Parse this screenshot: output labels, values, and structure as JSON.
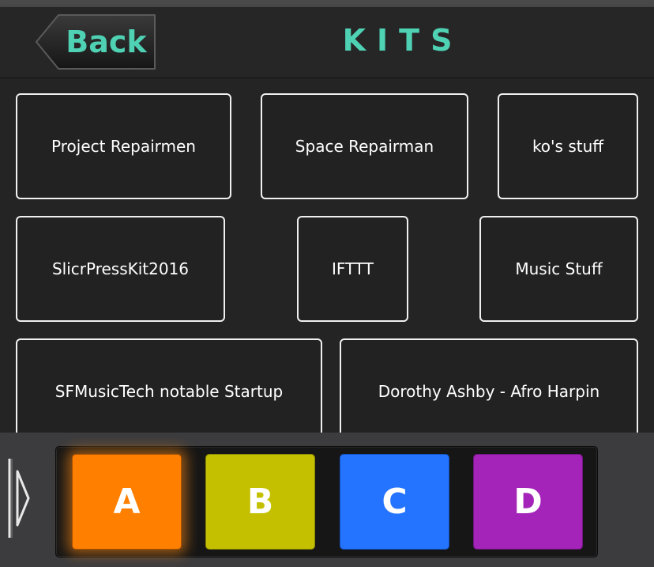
{
  "header": {
    "back_label": "Back",
    "title": "KITS"
  },
  "kits": [
    "Project Repairmen",
    "Space Repairman",
    "ko's stuff",
    "SlicrPressKit2016",
    "IFTTT",
    "Music Stuff",
    "SFMusicTech notable Startup",
    "Dorothy Ashby - Afro Harpin"
  ],
  "pads": [
    {
      "label": "A",
      "color": "#ff7f00",
      "active": true
    },
    {
      "label": "B",
      "color": "#c4c000",
      "active": false
    },
    {
      "label": "C",
      "color": "#2474ff",
      "active": false
    },
    {
      "label": "D",
      "color": "#a423b8",
      "active": false
    }
  ],
  "colors": {
    "accent": "#4fd1b4",
    "panel_bg": "#242424",
    "tile_border": "#f0f0f0"
  },
  "icons": {
    "drawer_handle": "chevron-right-icon"
  }
}
